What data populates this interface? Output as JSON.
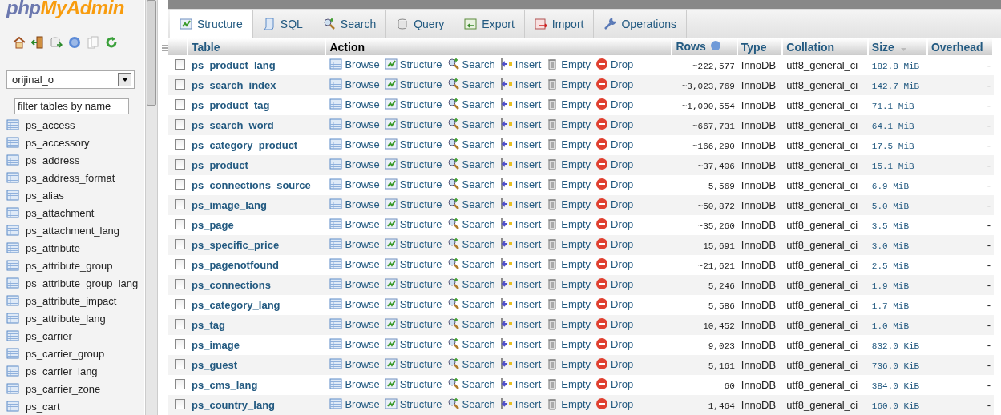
{
  "logo": {
    "part1": "php",
    "part2": "MyAdmin"
  },
  "sidebar": {
    "database_select": {
      "value": "orijinal_o"
    },
    "filter": {
      "placeholder": "filter tables by name"
    },
    "tables": [
      "ps_access",
      "ps_accessory",
      "ps_address",
      "ps_address_format",
      "ps_alias",
      "ps_attachment",
      "ps_attachment_lang",
      "ps_attribute",
      "ps_attribute_group",
      "ps_attribute_group_lang",
      "ps_attribute_impact",
      "ps_attribute_lang",
      "ps_carrier",
      "ps_carrier_group",
      "ps_carrier_lang",
      "ps_carrier_zone",
      "ps_cart"
    ]
  },
  "tabs": [
    {
      "label": "Structure",
      "selected": true
    },
    {
      "label": "SQL",
      "selected": false
    },
    {
      "label": "Search",
      "selected": false
    },
    {
      "label": "Query",
      "selected": false
    },
    {
      "label": "Export",
      "selected": false
    },
    {
      "label": "Import",
      "selected": false
    },
    {
      "label": "Operations",
      "selected": false
    }
  ],
  "table": {
    "columns": [
      "Table",
      "Action",
      "Rows",
      "Type",
      "Collation",
      "Size",
      "Overhead"
    ],
    "rows": [
      {
        "name": "ps_product_lang",
        "actions": [
          "Browse",
          "Structure",
          "Search",
          "Insert",
          "Empty",
          "Drop"
        ],
        "rows": "~222,577",
        "type": "InnoDB",
        "collation": "utf8_general_ci",
        "size": "182.8 MiB",
        "overhead": "-",
        "checked": false
      },
      {
        "name": "ps_search_index",
        "actions": [
          "Browse",
          "Structure",
          "Search",
          "Insert",
          "Empty",
          "Drop"
        ],
        "rows": "~3,023,769",
        "type": "InnoDB",
        "collation": "utf8_general_ci",
        "size": "142.7 MiB",
        "overhead": "-",
        "checked": false
      },
      {
        "name": "ps_product_tag",
        "actions": [
          "Browse",
          "Structure",
          "Search",
          "Insert",
          "Empty",
          "Drop"
        ],
        "rows": "~1,000,554",
        "type": "InnoDB",
        "collation": "utf8_general_ci",
        "size": "71.1 MiB",
        "overhead": "-",
        "checked": false
      },
      {
        "name": "ps_search_word",
        "actions": [
          "Browse",
          "Structure",
          "Search",
          "Insert",
          "Empty",
          "Drop"
        ],
        "rows": "~667,731",
        "type": "InnoDB",
        "collation": "utf8_general_ci",
        "size": "64.1 MiB",
        "overhead": "-",
        "checked": false
      },
      {
        "name": "ps_category_product",
        "actions": [
          "Browse",
          "Structure",
          "Search",
          "Insert",
          "Empty",
          "Drop"
        ],
        "rows": "~166,290",
        "type": "InnoDB",
        "collation": "utf8_general_ci",
        "size": "17.5 MiB",
        "overhead": "-",
        "checked": false
      },
      {
        "name": "ps_product",
        "actions": [
          "Browse",
          "Structure",
          "Search",
          "Insert",
          "Empty",
          "Drop"
        ],
        "rows": "~37,406",
        "type": "InnoDB",
        "collation": "utf8_general_ci",
        "size": "15.1 MiB",
        "overhead": "-",
        "checked": false
      },
      {
        "name": "ps_connections_source",
        "actions": [
          "Browse",
          "Structure",
          "Search",
          "Insert",
          "Empty",
          "Drop"
        ],
        "rows": "5,569",
        "type": "InnoDB",
        "collation": "utf8_general_ci",
        "size": "6.9 MiB",
        "overhead": "-",
        "checked": false
      },
      {
        "name": "ps_image_lang",
        "actions": [
          "Browse",
          "Structure",
          "Search",
          "Insert",
          "Empty",
          "Drop"
        ],
        "rows": "~50,872",
        "type": "InnoDB",
        "collation": "utf8_general_ci",
        "size": "5.0 MiB",
        "overhead": "-",
        "checked": false
      },
      {
        "name": "ps_page",
        "actions": [
          "Browse",
          "Structure",
          "Search",
          "Insert",
          "Empty",
          "Drop"
        ],
        "rows": "~35,260",
        "type": "InnoDB",
        "collation": "utf8_general_ci",
        "size": "3.5 MiB",
        "overhead": "-",
        "checked": false
      },
      {
        "name": "ps_specific_price",
        "actions": [
          "Browse",
          "Structure",
          "Search",
          "Insert",
          "Empty",
          "Drop"
        ],
        "rows": "15,691",
        "type": "InnoDB",
        "collation": "utf8_general_ci",
        "size": "3.0 MiB",
        "overhead": "-",
        "checked": false
      },
      {
        "name": "ps_pagenotfound",
        "actions": [
          "Browse",
          "Structure",
          "Search",
          "Insert",
          "Empty",
          "Drop"
        ],
        "rows": "~21,621",
        "type": "InnoDB",
        "collation": "utf8_general_ci",
        "size": "2.5 MiB",
        "overhead": "-",
        "checked": false
      },
      {
        "name": "ps_connections",
        "actions": [
          "Browse",
          "Structure",
          "Search",
          "Insert",
          "Empty",
          "Drop"
        ],
        "rows": "5,246",
        "type": "InnoDB",
        "collation": "utf8_general_ci",
        "size": "1.9 MiB",
        "overhead": "-",
        "checked": false
      },
      {
        "name": "ps_category_lang",
        "actions": [
          "Browse",
          "Structure",
          "Search",
          "Insert",
          "Empty",
          "Drop"
        ],
        "rows": "5,586",
        "type": "InnoDB",
        "collation": "utf8_general_ci",
        "size": "1.7 MiB",
        "overhead": "-",
        "checked": false
      },
      {
        "name": "ps_tag",
        "actions": [
          "Browse",
          "Structure",
          "Search",
          "Insert",
          "Empty",
          "Drop"
        ],
        "rows": "10,452",
        "type": "InnoDB",
        "collation": "utf8_general_ci",
        "size": "1.0 MiB",
        "overhead": "-",
        "checked": false
      },
      {
        "name": "ps_image",
        "actions": [
          "Browse",
          "Structure",
          "Search",
          "Insert",
          "Empty",
          "Drop"
        ],
        "rows": "9,023",
        "type": "InnoDB",
        "collation": "utf8_general_ci",
        "size": "832.0 KiB",
        "overhead": "-",
        "checked": false
      },
      {
        "name": "ps_guest",
        "actions": [
          "Browse",
          "Structure",
          "Search",
          "Insert",
          "Empty",
          "Drop"
        ],
        "rows": "5,161",
        "type": "InnoDB",
        "collation": "utf8_general_ci",
        "size": "736.0 KiB",
        "overhead": "-",
        "checked": false
      },
      {
        "name": "ps_cms_lang",
        "actions": [
          "Browse",
          "Structure",
          "Search",
          "Insert",
          "Empty",
          "Drop"
        ],
        "rows": "60",
        "type": "InnoDB",
        "collation": "utf8_general_ci",
        "size": "384.0 KiB",
        "overhead": "-",
        "checked": false
      },
      {
        "name": "ps_country_lang",
        "actions": [
          "Browse",
          "Structure",
          "Search",
          "Insert",
          "Empty",
          "Drop"
        ],
        "rows": "1,464",
        "type": "InnoDB",
        "collation": "utf8_general_ci",
        "size": "160.0 KiB",
        "overhead": "-",
        "checked": false
      }
    ]
  }
}
